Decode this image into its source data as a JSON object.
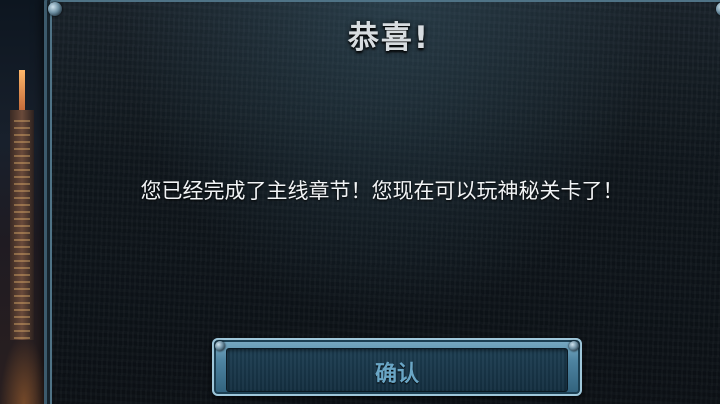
{
  "dialog": {
    "title": "恭喜!",
    "message": "您已经完成了主线章节！您现在可以玩神秘关卡了！"
  },
  "confirm_button": {
    "label": "确认"
  },
  "colors": {
    "panel_border": "#4f7386",
    "button_accent": "#4d83a0",
    "title_text": "#d7dce0",
    "button_text": "#6aa6c6"
  }
}
